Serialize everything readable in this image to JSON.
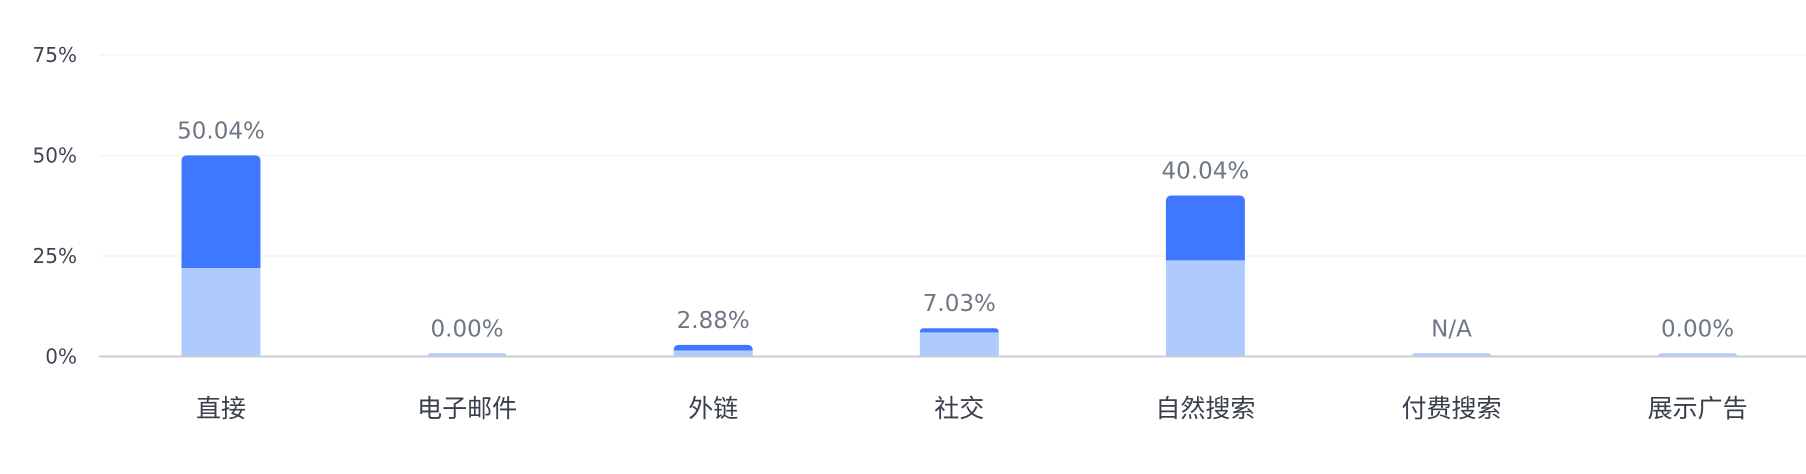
{
  "chart_data": {
    "type": "bar",
    "stacked": true,
    "categories": [
      "直接",
      "电子邮件",
      "外链",
      "社交",
      "自然搜索",
      "付费搜索",
      "展示广告"
    ],
    "series": [
      {
        "values": [
          22.0,
          0.8,
          1.5,
          6.0,
          23.9,
          0.8,
          0.8
        ],
        "color": "#aecaff"
      },
      {
        "values": [
          28.04,
          0,
          1.38,
          1.03,
          16.14,
          0,
          0
        ],
        "color": "#3f78fe"
      }
    ],
    "data_labels": [
      "50.04%",
      "0.00%",
      "2.88%",
      "7.03%",
      "40.04%",
      "N/A",
      "0.00%"
    ],
    "y_ticks": [
      {
        "value": 0,
        "label": "0%"
      },
      {
        "value": 25,
        "label": "25%"
      },
      {
        "value": 50,
        "label": "50%"
      },
      {
        "value": 75,
        "label": "75%"
      }
    ],
    "ylim": [
      0,
      75
    ],
    "grid": true,
    "colors": {
      "grid": "#f1f2f4",
      "baseline": "#c9ccd2"
    }
  }
}
